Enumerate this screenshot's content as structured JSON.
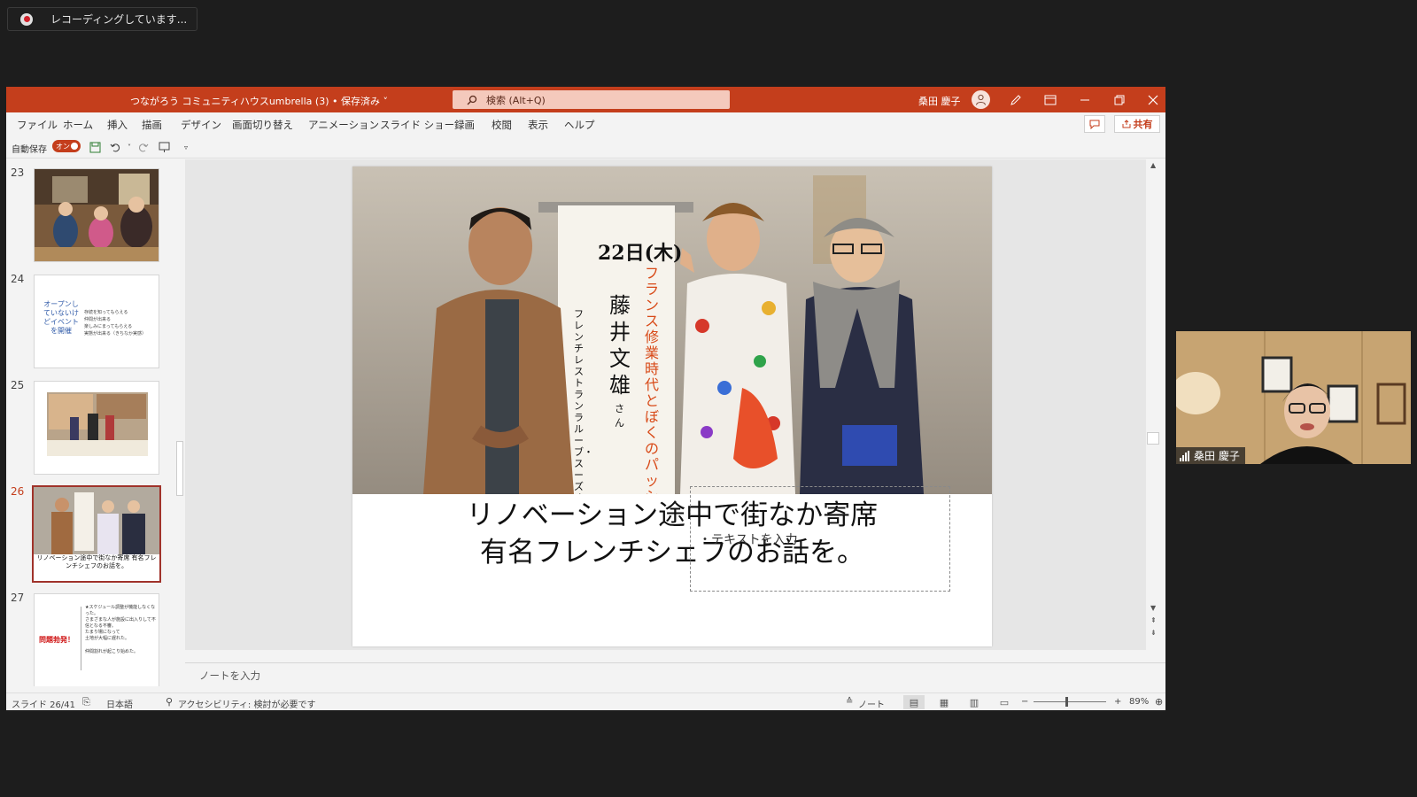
{
  "recording": {
    "label": "レコーディングしています..."
  },
  "titlebar": {
    "doc_title": "つながろう コミュニティハウスumbrella (3) • 保存済み ˅",
    "search_placeholder": "検索 (Alt+Q)",
    "user_name": "桑田 慶子"
  },
  "menu": [
    "ファイル",
    "ホーム",
    "挿入",
    "描画",
    "デザイン",
    "画面切り替え",
    "アニメーション",
    "スライド ショー",
    "録画",
    "校閲",
    "表示",
    "ヘルプ"
  ],
  "share_label": "共有",
  "qat": {
    "autosave_label": "自動保存",
    "toggle_label": "オン"
  },
  "thumbnails": [
    {
      "number": "23",
      "active": false
    },
    {
      "number": "24",
      "active": false,
      "title": "オープンしていないけどイベントを開催",
      "bullets": [
        "存続を知ってもらえる",
        "仲間が出来る",
        "楽しみにまってもらえる",
        "実態が出来る（きちなか実感）"
      ]
    },
    {
      "number": "25",
      "active": false
    },
    {
      "number": "26",
      "active": true,
      "caption": "リノベーション途中で街なか寄席 有名フレンチシェフのお話を。"
    },
    {
      "number": "27",
      "active": false,
      "label": "問題勃発！",
      "lines": [
        "★スケジュール調整が機能しなくなった。",
        "さまざまな人が施設に出入りして不信となる不審。",
        "たまり場になって",
        "土地が大幅に遅れた。",
        "仲間割れが起こり始めた。"
      ]
    }
  ],
  "slide": {
    "caption_line1": "リノベーション途中で街なか寄席",
    "caption_line2": "有名フレンチシェフのお話を。",
    "placeholder": "・テキストを入力",
    "scroll_date": "22日(木)",
    "scroll_name": "藤井文雄",
    "scroll_suffix": "さん",
    "scroll_red": "フランス修業時代とぼくのパッション",
    "scroll_role": "フレンチレストラン ラルーブ・スーズ オーナーシェフ"
  },
  "notes_placeholder": "ノートを入力",
  "status": {
    "slide_counter": "スライド 26/41",
    "language": "日本語",
    "accessibility": "アクセシビリティ: 検討が必要です",
    "notes_label": "ノート",
    "zoom_minus": "−",
    "zoom_plus": "+",
    "zoom": "89%"
  },
  "webcam": {
    "name": "桑田 慶子"
  },
  "colors": {
    "accent": "#c43e1c",
    "titlebar": "#c43e1c",
    "background": "#1d1d1d"
  }
}
